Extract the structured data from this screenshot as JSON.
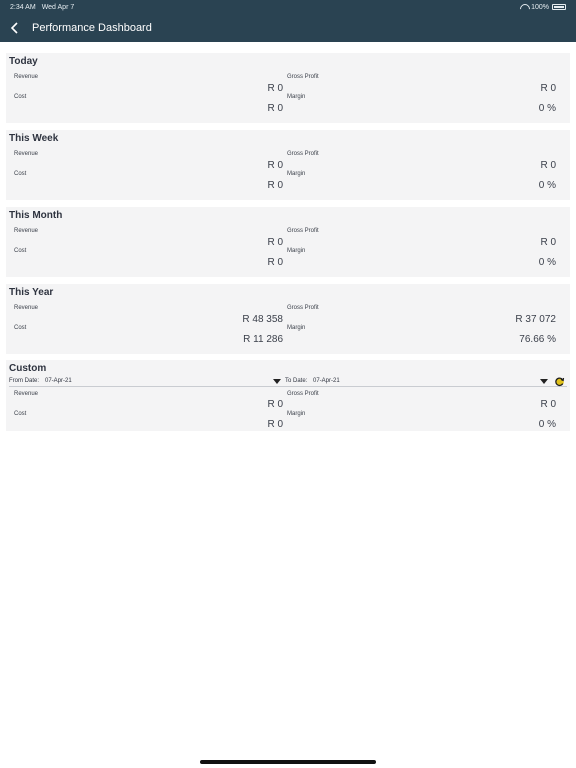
{
  "status": {
    "time": "2:34 AM",
    "date": "Wed Apr 7",
    "battery": "100%"
  },
  "header": {
    "title": "Performance Dashboard"
  },
  "labels": {
    "revenue": "Revenue",
    "cost": "Cost",
    "gross_profit": "Gross Profit",
    "margin": "Margin"
  },
  "cards": [
    {
      "title": "Today",
      "revenue": "R 0",
      "cost": "R 0",
      "gross_profit": "R 0",
      "margin": "0 %"
    },
    {
      "title": "This Week",
      "revenue": "R 0",
      "cost": "R 0",
      "gross_profit": "R 0",
      "margin": "0 %"
    },
    {
      "title": "This Month",
      "revenue": "R 0",
      "cost": "R 0",
      "gross_profit": "R 0",
      "margin": "0 %"
    },
    {
      "title": "This Year",
      "revenue": "R 48 358",
      "cost": "R 11 286",
      "gross_profit": "R 37 072",
      "margin": "76.66 %"
    }
  ],
  "custom": {
    "title": "Custom",
    "from_label": "From Date:",
    "from_value": "07-Apr-21",
    "to_label": "To Date:",
    "to_value": "07-Apr-21",
    "revenue": "R 0",
    "cost": "R 0",
    "gross_profit": "R 0",
    "margin": "0 %"
  },
  "icons": {
    "back": "chevron-left-icon",
    "dropdown": "triangle-down-icon",
    "refresh": "refresh-icon"
  },
  "colors": {
    "header_bg": "#2a4352",
    "card_bg": "#f4f4f5",
    "refresh_accent": "#e0c11a"
  }
}
